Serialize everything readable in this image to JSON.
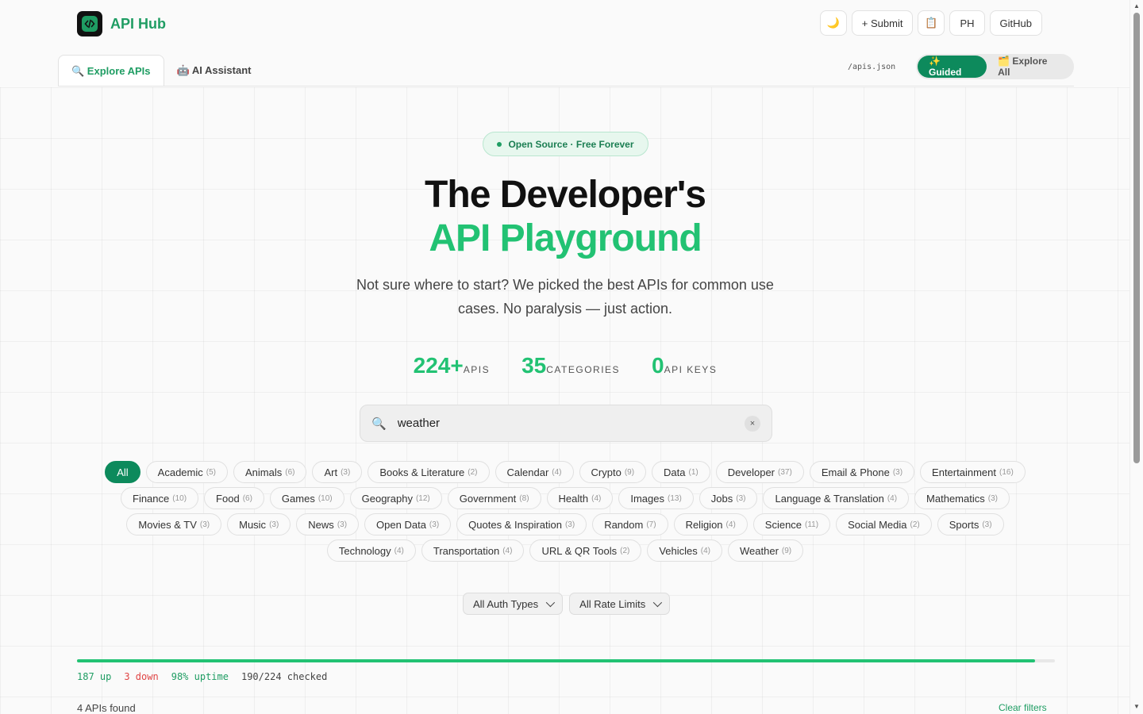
{
  "header": {
    "app_name": "API Hub",
    "actions": {
      "theme_icon": "moon-icon",
      "theme_glyph": "🌙",
      "submit": "+ Submit",
      "clipboard_icon": "clipboard-icon",
      "clipboard_glyph": "📋",
      "ph": "PH",
      "github": "GitHub"
    }
  },
  "tabs": [
    {
      "label": "🔍 Explore APIs"
    },
    {
      "label": "🤖 AI Assistant"
    }
  ],
  "json_link": "/apis.json",
  "mode_toggle": {
    "guided": "✨ Guided",
    "explore": "🗂️ Explore All"
  },
  "hero": {
    "badge": "Open Source · Free Forever",
    "title_line1": "The Developer's",
    "title_line2": "API Playground",
    "subtitle": "Not sure where to start? We picked the best APIs for common use cases. No paralysis — just action."
  },
  "stats": [
    {
      "value": "224+",
      "label": "APIS"
    },
    {
      "value": "35",
      "label": "CATEGORIES"
    },
    {
      "value": "0",
      "label": "API KEYS"
    }
  ],
  "search": {
    "value": "weather",
    "clear": "×"
  },
  "categories": [
    {
      "name": "All",
      "count": ""
    },
    {
      "name": "Academic",
      "count": "(5)"
    },
    {
      "name": "Animals",
      "count": "(6)"
    },
    {
      "name": "Art",
      "count": "(3)"
    },
    {
      "name": "Books & Literature",
      "count": "(2)"
    },
    {
      "name": "Calendar",
      "count": "(4)"
    },
    {
      "name": "Crypto",
      "count": "(9)"
    },
    {
      "name": "Data",
      "count": "(1)"
    },
    {
      "name": "Developer",
      "count": "(37)"
    },
    {
      "name": "Email & Phone",
      "count": "(3)"
    },
    {
      "name": "Entertainment",
      "count": "(16)"
    },
    {
      "name": "Finance",
      "count": "(10)"
    },
    {
      "name": "Food",
      "count": "(6)"
    },
    {
      "name": "Games",
      "count": "(10)"
    },
    {
      "name": "Geography",
      "count": "(12)"
    },
    {
      "name": "Government",
      "count": "(8)"
    },
    {
      "name": "Health",
      "count": "(4)"
    },
    {
      "name": "Images",
      "count": "(13)"
    },
    {
      "name": "Jobs",
      "count": "(3)"
    },
    {
      "name": "Language & Translation",
      "count": "(4)"
    },
    {
      "name": "Mathematics",
      "count": "(3)"
    },
    {
      "name": "Movies & TV",
      "count": "(3)"
    },
    {
      "name": "Music",
      "count": "(3)"
    },
    {
      "name": "News",
      "count": "(3)"
    },
    {
      "name": "Open Data",
      "count": "(3)"
    },
    {
      "name": "Quotes & Inspiration",
      "count": "(3)"
    },
    {
      "name": "Random",
      "count": "(7)"
    },
    {
      "name": "Religion",
      "count": "(4)"
    },
    {
      "name": "Science",
      "count": "(11)"
    },
    {
      "name": "Social Media",
      "count": "(2)"
    },
    {
      "name": "Sports",
      "count": "(3)"
    },
    {
      "name": "Technology",
      "count": "(4)"
    },
    {
      "name": "Transportation",
      "count": "(4)"
    },
    {
      "name": "URL & QR Tools",
      "count": "(2)"
    },
    {
      "name": "Vehicles",
      "count": "(4)"
    },
    {
      "name": "Weather",
      "count": "(9)"
    }
  ],
  "filters": {
    "auth": "All Auth Types",
    "rate": "All Rate Limits"
  },
  "health": {
    "progress_fraction": 0.98,
    "up": "187 up",
    "down": "3 down",
    "uptime": "98% uptime",
    "checked": "190/224 checked"
  },
  "results": {
    "found": "4 APIs found",
    "clear_filters": "Clear filters"
  },
  "colors": {
    "accent": "#22c273",
    "accent_dark": "#0d8a5c",
    "down": "#e04545"
  }
}
